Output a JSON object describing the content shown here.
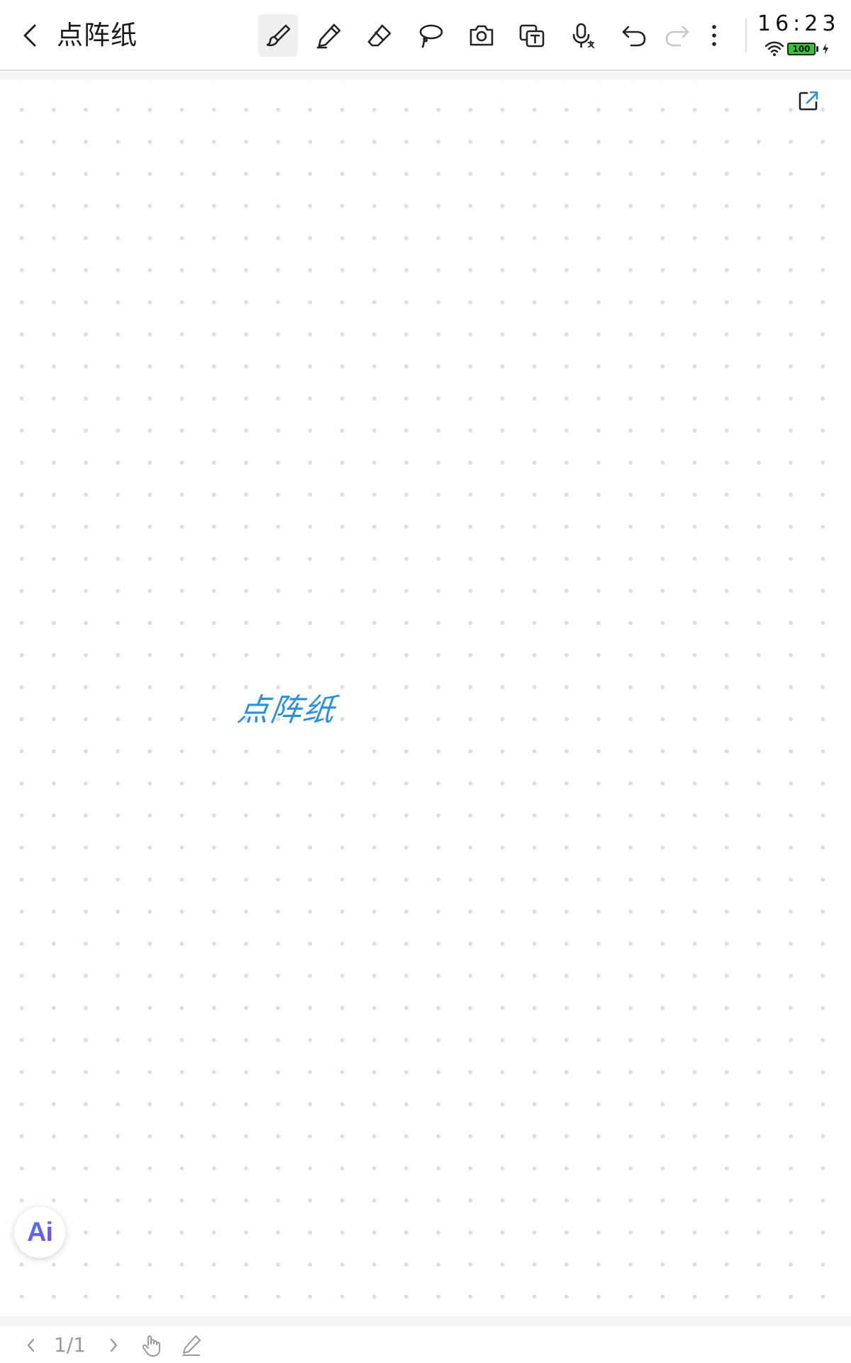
{
  "header": {
    "title": "点阵纸"
  },
  "toolbar": {
    "tools": [
      {
        "name": "brush",
        "selected": true
      },
      {
        "name": "pen",
        "selected": false
      },
      {
        "name": "eraser",
        "selected": false
      },
      {
        "name": "lasso",
        "selected": false
      },
      {
        "name": "camera",
        "selected": false
      },
      {
        "name": "text-recognition",
        "selected": false
      },
      {
        "name": "voice-to-text",
        "selected": false
      },
      {
        "name": "undo",
        "selected": false
      },
      {
        "name": "redo",
        "selected": false,
        "disabled": true
      },
      {
        "name": "more",
        "selected": false
      }
    ]
  },
  "status_bar": {
    "time": "16:23",
    "battery": "100"
  },
  "canvas": {
    "handwriting_text": "点阵纸",
    "handwriting_color": "#2b8fe0",
    "paper_style": "dot-grid"
  },
  "ai_button": {
    "label": "Ai"
  },
  "footer": {
    "page_indicator": "1/1"
  },
  "colors": {
    "accent_blue": "#2b8fe0",
    "battery_green": "#35c435",
    "ai_gradient_start": "#3d7bff",
    "ai_gradient_end": "#8a44e8"
  }
}
